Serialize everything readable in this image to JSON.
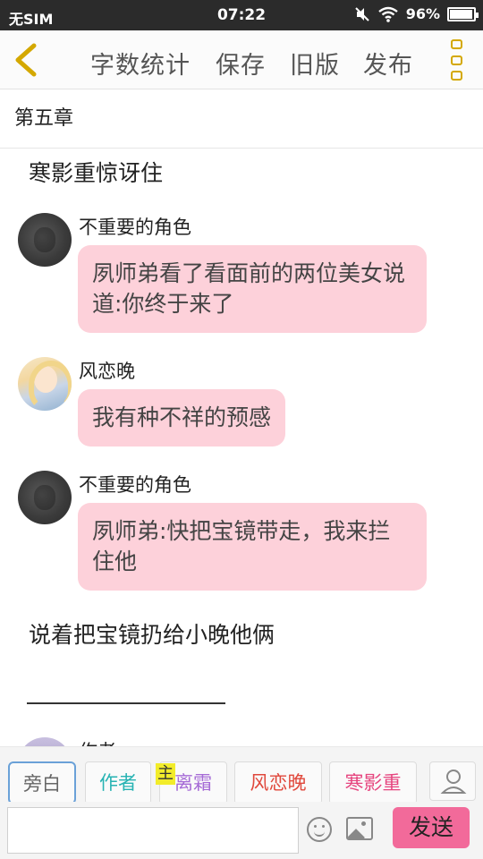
{
  "status_bar": {
    "carrier": "无SIM",
    "time": "07:22",
    "battery": "96%",
    "battery_level": 0.96,
    "icons": [
      "mute-icon",
      "wifi-icon",
      "battery-icon"
    ]
  },
  "toolbar": {
    "back_icon": "chevron-left-icon",
    "word_count": "字数统计",
    "save": "保存",
    "old_version": "旧版",
    "publish": "发布",
    "more_icon": "more-vertical-icon",
    "accent_color": "#d4a800"
  },
  "chapter": {
    "title": "第五章"
  },
  "content": {
    "narration_1": "寒影重惊讶住",
    "messages": [
      {
        "sender": "不重要的角色",
        "text": "夙师弟看了看面前的两位美女说道:你终于来了",
        "avatar": "dark"
      },
      {
        "sender": "风恋晚",
        "text": "我有种不祥的预感",
        "avatar": "anime"
      },
      {
        "sender": "不重要的角色",
        "text": "夙师弟:快把宝镜带走，我来拦住他",
        "avatar": "dark"
      }
    ],
    "narration_2": "说着把宝镜扔给小晚他俩",
    "partial_sender": "作者"
  },
  "roles": [
    {
      "label": "旁白",
      "color": "#666666"
    },
    {
      "label": "作者",
      "color": "#27b3b3"
    },
    {
      "label": "离霜",
      "color": "#a56ad6"
    },
    {
      "label": "风恋晚",
      "color": "#e0483c"
    },
    {
      "label": "寒影重",
      "color": "#e6457f"
    }
  ],
  "main_tag": "主",
  "input": {
    "placeholder": "",
    "send": "发送",
    "send_color": "#f26a9a"
  }
}
